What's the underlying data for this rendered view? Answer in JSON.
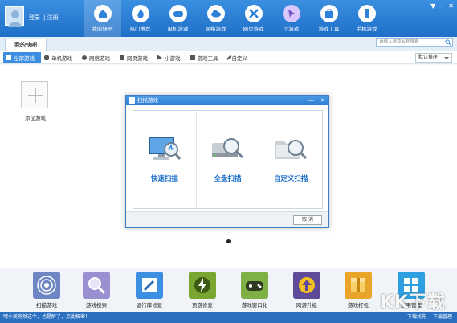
{
  "header": {
    "login": "登录",
    "register": "注册",
    "nav": [
      {
        "label": "我的快吧",
        "icon": "home-icon"
      },
      {
        "label": "热门推荐",
        "icon": "fire-icon"
      },
      {
        "label": "单机游戏",
        "icon": "gamepad-icon"
      },
      {
        "label": "网络游戏",
        "icon": "cloud-icon"
      },
      {
        "label": "网页游戏",
        "icon": "tools-icon"
      },
      {
        "label": "小游戏",
        "icon": "cursor-icon"
      },
      {
        "label": "游戏工具",
        "icon": "toolbox-icon"
      },
      {
        "label": "手机游戏",
        "icon": "phone-icon"
      }
    ],
    "search_placeholder": "请输入游戏名称搜索"
  },
  "subtab": {
    "label": "我的快吧"
  },
  "categories": [
    {
      "label": "全部游戏",
      "active": true
    },
    {
      "label": "单机游戏"
    },
    {
      "label": "网络游戏"
    },
    {
      "label": "网页游戏"
    },
    {
      "label": "小游戏"
    },
    {
      "label": "游戏工具"
    },
    {
      "label": "自定义"
    }
  ],
  "sort": {
    "value": "默认排序"
  },
  "main": {
    "add_label": "添加游戏"
  },
  "dialog": {
    "title": "扫描游戏",
    "options": [
      {
        "label": "快速扫描",
        "icon": "monitor-scan-icon"
      },
      {
        "label": "全盘扫描",
        "icon": "disk-scan-icon"
      },
      {
        "label": "自定义扫描",
        "icon": "folder-scan-icon"
      }
    ],
    "cancel": "取 消"
  },
  "tools": [
    {
      "label": "扫描游戏",
      "icon": "radar-icon",
      "color": "#6f86c4"
    },
    {
      "label": "游戏搜索",
      "icon": "magnifier-icon",
      "color": "#9a8fd0"
    },
    {
      "label": "运行库修复",
      "icon": "wrench-icon",
      "color": "#3b8ee0"
    },
    {
      "label": "页游修复",
      "icon": "lightning-icon",
      "color": "#7aa530"
    },
    {
      "label": "游戏窗口化",
      "icon": "controller-icon",
      "color": "#7fb045"
    },
    {
      "label": "网游升级",
      "icon": "upgrade-icon",
      "color": "#5f4a9a"
    },
    {
      "label": "游戏打包",
      "icon": "package-icon",
      "color": "#e9a52a"
    },
    {
      "label": "应用管理",
      "icon": "apps-icon",
      "color": "#2d9fe0"
    }
  ],
  "status": {
    "message": "嘿小美竟然这个，也是醉了，点此解密！",
    "download_priority": "下载优先",
    "download_manager": "下载管理"
  },
  "watermark": "KK下载"
}
